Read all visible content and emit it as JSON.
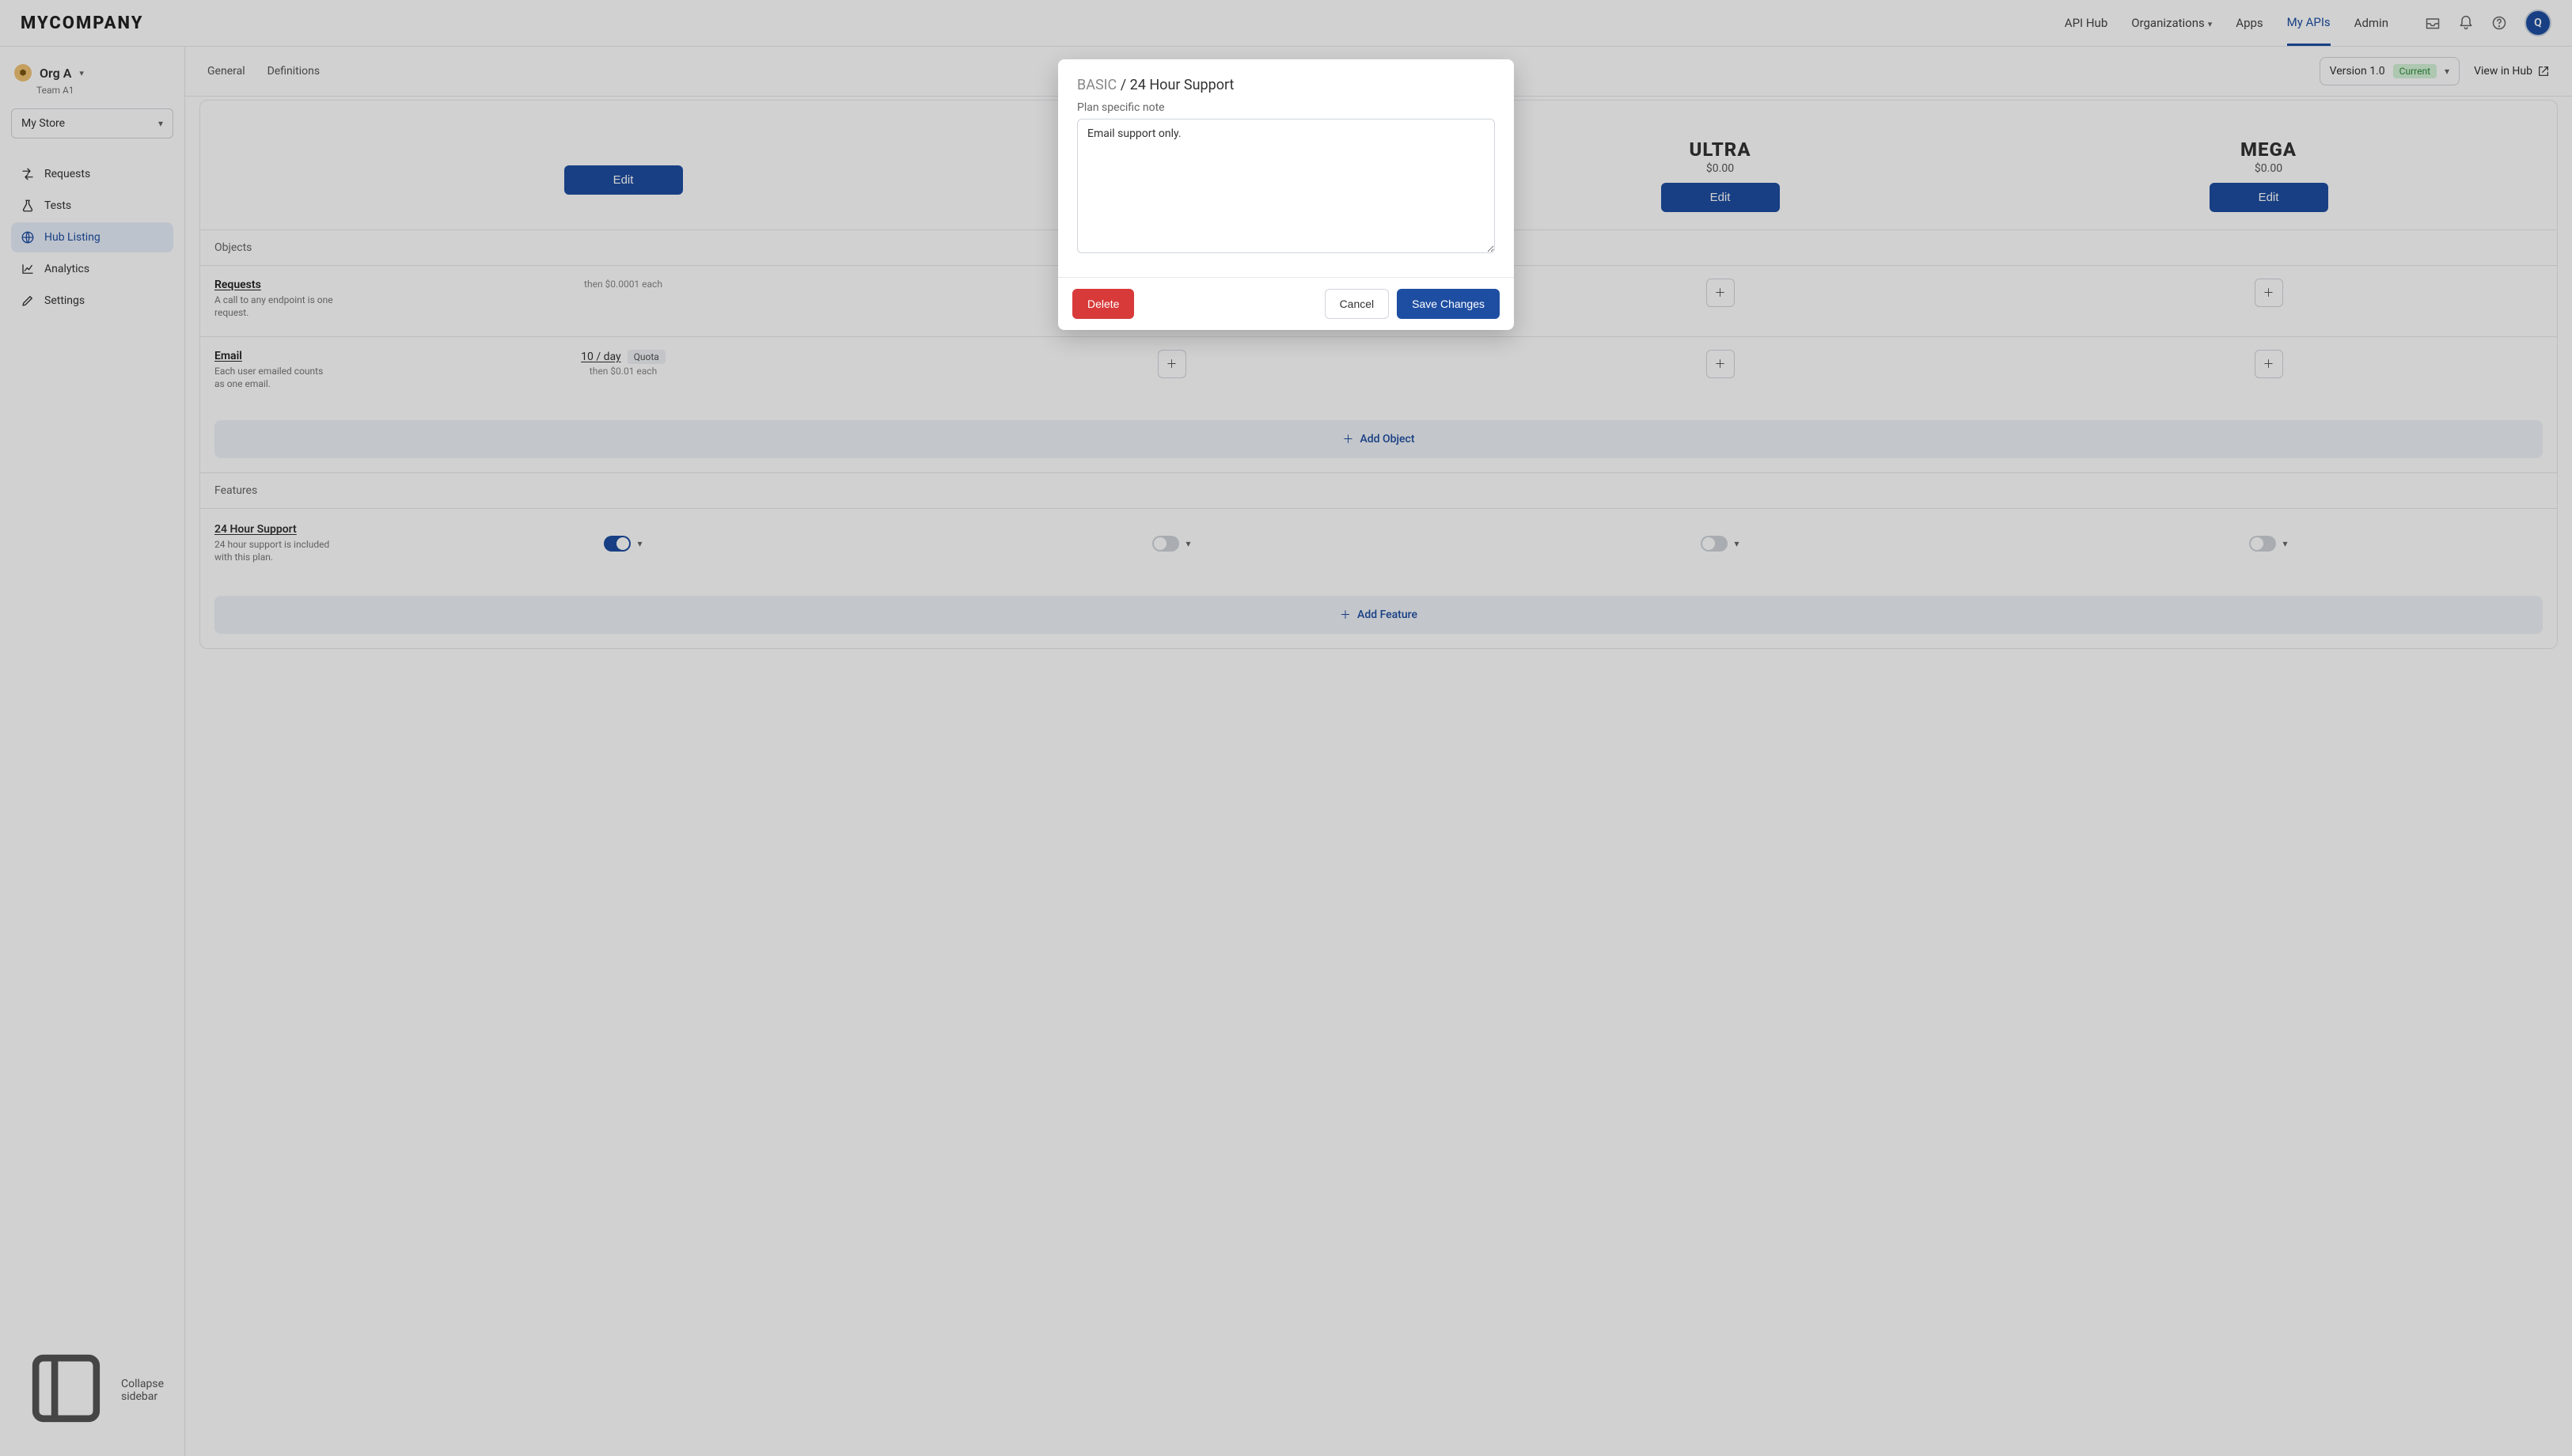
{
  "brand": "MYCOMPANY",
  "topnav": {
    "api_hub": "API Hub",
    "organizations": "Organizations",
    "apps": "Apps",
    "my_apis": "My APIs",
    "admin": "Admin"
  },
  "avatar_initial": "Q",
  "org": {
    "name": "Org A",
    "team": "Team A1",
    "store": "My Store"
  },
  "sidebar": {
    "requests": "Requests",
    "tests": "Tests",
    "hub_listing": "Hub Listing",
    "analytics": "Analytics",
    "settings": "Settings",
    "collapse": "Collapse sidebar"
  },
  "subtabs": {
    "general": "General",
    "definitions": "Definitions"
  },
  "version": {
    "label": "Version 1.0",
    "badge": "Current"
  },
  "view_in_hub": "View in Hub",
  "plans": [
    {
      "toggle": null,
      "name": "",
      "price": "",
      "edit": "Edit"
    },
    {
      "toggle": null,
      "name": "",
      "price": "",
      "edit": "Edit"
    },
    {
      "toggle": false,
      "name": "ULTRA",
      "price": "$0.00",
      "edit": "Edit"
    },
    {
      "toggle": false,
      "name": "MEGA",
      "price": "$0.00",
      "edit": "Edit"
    }
  ],
  "objects_title": "Objects",
  "objects": [
    {
      "name": "Requests",
      "desc": "A call to any endpoint is one request.",
      "cells": [
        {
          "type": "quota_hidden",
          "sub": "then $0.0001 each"
        },
        {
          "type": "plus"
        },
        {
          "type": "plus"
        },
        {
          "type": "plus"
        }
      ]
    },
    {
      "name": "Email",
      "desc": "Each user emailed counts as one email.",
      "cells": [
        {
          "type": "quota",
          "value": "10 / day",
          "badge": "Quota",
          "sub": "then $0.01 each"
        },
        {
          "type": "plus"
        },
        {
          "type": "plus"
        },
        {
          "type": "plus"
        }
      ]
    }
  ],
  "add_object": "Add Object",
  "features_title": "Features",
  "features": [
    {
      "name": "24 Hour Support",
      "desc": "24 hour support is included with this plan.",
      "toggles": [
        true,
        false,
        false,
        false
      ]
    }
  ],
  "add_feature": "Add Feature",
  "modal": {
    "plan_slug": "BASIC",
    "feature_name": "24 Hour Support",
    "subtitle": "Plan specific note",
    "note_value": "Email support only.",
    "delete": "Delete",
    "cancel": "Cancel",
    "save": "Save Changes"
  }
}
